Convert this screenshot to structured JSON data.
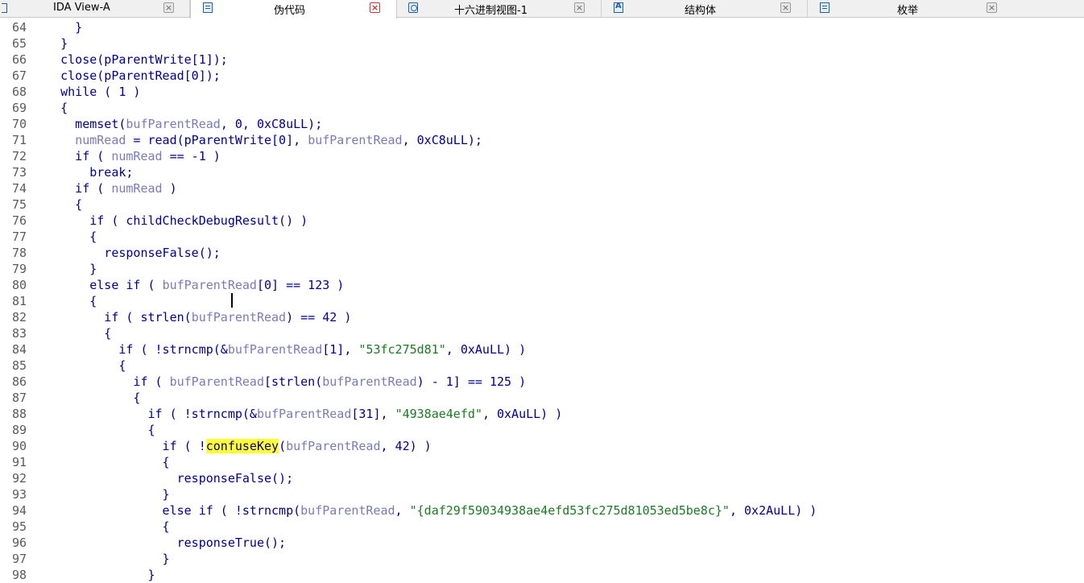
{
  "tabs": [
    {
      "label": "IDA View-A",
      "icon": "ida-view-icon",
      "active": false
    },
    {
      "label": "伪代码",
      "icon": "pseudocode-icon",
      "active": true
    },
    {
      "label": "十六进制视图-1",
      "icon": "hex-view-icon",
      "active": false
    },
    {
      "label": "结构体",
      "icon": "structures-icon",
      "active": false
    },
    {
      "label": "枚举",
      "icon": "enums-icon",
      "active": false
    }
  ],
  "tab_close_glyph": "×",
  "code": {
    "lines": [
      {
        "n": "64",
        "t": [
          [
            "      }",
            ""
          ]
        ]
      },
      {
        "n": "65",
        "t": [
          [
            "    }",
            ""
          ]
        ]
      },
      {
        "n": "66",
        "t": [
          [
            "    close(pParentWrite[1]);",
            ""
          ]
        ]
      },
      {
        "n": "67",
        "t": [
          [
            "    close(pParentRead[0]);",
            ""
          ]
        ]
      },
      {
        "n": "68",
        "t": [
          [
            "    while ( 1 )",
            ""
          ]
        ]
      },
      {
        "n": "69",
        "t": [
          [
            "    {",
            ""
          ]
        ]
      },
      {
        "n": "70",
        "t": [
          [
            "      memset(",
            ""
          ],
          [
            "bufParentRead",
            "v"
          ],
          [
            ", 0, 0xC8uLL);",
            ""
          ]
        ]
      },
      {
        "n": "71",
        "t": [
          [
            "      ",
            ""
          ],
          [
            "numRead",
            "v"
          ],
          [
            " = read(pParentWrite[0], ",
            ""
          ],
          [
            "bufParentRead",
            "v"
          ],
          [
            ", 0xC8uLL);",
            ""
          ]
        ]
      },
      {
        "n": "72",
        "t": [
          [
            "      if ( ",
            ""
          ],
          [
            "numRead",
            "v"
          ],
          [
            " == -1 )",
            ""
          ]
        ]
      },
      {
        "n": "73",
        "t": [
          [
            "        break;",
            ""
          ]
        ]
      },
      {
        "n": "74",
        "t": [
          [
            "      if ( ",
            ""
          ],
          [
            "numRead",
            "v"
          ],
          [
            " )",
            ""
          ]
        ]
      },
      {
        "n": "75",
        "t": [
          [
            "      {",
            ""
          ]
        ]
      },
      {
        "n": "76",
        "t": [
          [
            "        if ( childCheckDebugResult() )",
            ""
          ]
        ]
      },
      {
        "n": "77",
        "t": [
          [
            "        {",
            ""
          ]
        ]
      },
      {
        "n": "78",
        "t": [
          [
            "          responseFalse();",
            ""
          ]
        ]
      },
      {
        "n": "79",
        "t": [
          [
            "        }",
            ""
          ]
        ]
      },
      {
        "n": "80",
        "t": [
          [
            "        else if ( ",
            ""
          ],
          [
            "bufParentRead",
            "v"
          ],
          [
            "[0] == 123 )",
            ""
          ]
        ]
      },
      {
        "n": "81",
        "t": [
          [
            "        {",
            ""
          ]
        ]
      },
      {
        "n": "82",
        "t": [
          [
            "          if ( strlen(",
            ""
          ],
          [
            "bufParentRead",
            "v"
          ],
          [
            ") == 42 )",
            ""
          ]
        ]
      },
      {
        "n": "83",
        "t": [
          [
            "          {",
            ""
          ]
        ]
      },
      {
        "n": "84",
        "t": [
          [
            "            if ( !strncmp(&",
            ""
          ],
          [
            "bufParentRead",
            "v"
          ],
          [
            "[1], ",
            ""
          ],
          [
            "\"53fc275d81\"",
            "s"
          ],
          [
            ", 0xAuLL) )",
            ""
          ]
        ]
      },
      {
        "n": "85",
        "t": [
          [
            "            {",
            ""
          ]
        ]
      },
      {
        "n": "86",
        "t": [
          [
            "              if ( ",
            ""
          ],
          [
            "bufParentRead",
            "v"
          ],
          [
            "[strlen(",
            ""
          ],
          [
            "bufParentRead",
            "v"
          ],
          [
            ") - 1] == 125 )",
            ""
          ]
        ]
      },
      {
        "n": "87",
        "t": [
          [
            "              {",
            ""
          ]
        ]
      },
      {
        "n": "88",
        "t": [
          [
            "                if ( !strncmp(&",
            ""
          ],
          [
            "bufParentRead",
            "v"
          ],
          [
            "[31], ",
            ""
          ],
          [
            "\"4938ae4efd\"",
            "s"
          ],
          [
            ", 0xAuLL) )",
            ""
          ]
        ]
      },
      {
        "n": "89",
        "t": [
          [
            "                {",
            ""
          ]
        ]
      },
      {
        "n": "90",
        "t": [
          [
            "                  if ( !",
            ""
          ],
          [
            "confuseKey",
            "hl"
          ],
          [
            "(",
            ""
          ],
          [
            "bufParentRead",
            "v"
          ],
          [
            ", 42) )",
            ""
          ]
        ]
      },
      {
        "n": "91",
        "t": [
          [
            "                  {",
            ""
          ]
        ]
      },
      {
        "n": "92",
        "t": [
          [
            "                    responseFalse();",
            ""
          ]
        ]
      },
      {
        "n": "93",
        "t": [
          [
            "                  }",
            ""
          ]
        ]
      },
      {
        "n": "94",
        "t": [
          [
            "                  else if ( !strncmp(",
            ""
          ],
          [
            "bufParentRead",
            "v"
          ],
          [
            ", ",
            ""
          ],
          [
            "\"{daf29f59034938ae4efd53fc275d81053ed5be8c}\"",
            "s"
          ],
          [
            ", 0x2AuLL) )",
            ""
          ]
        ]
      },
      {
        "n": "95",
        "t": [
          [
            "                  {",
            ""
          ]
        ]
      },
      {
        "n": "96",
        "t": [
          [
            "                    responseTrue();",
            ""
          ]
        ]
      },
      {
        "n": "97",
        "t": [
          [
            "                  }",
            ""
          ]
        ]
      },
      {
        "n": "98",
        "t": [
          [
            "                }",
            ""
          ]
        ]
      }
    ]
  }
}
